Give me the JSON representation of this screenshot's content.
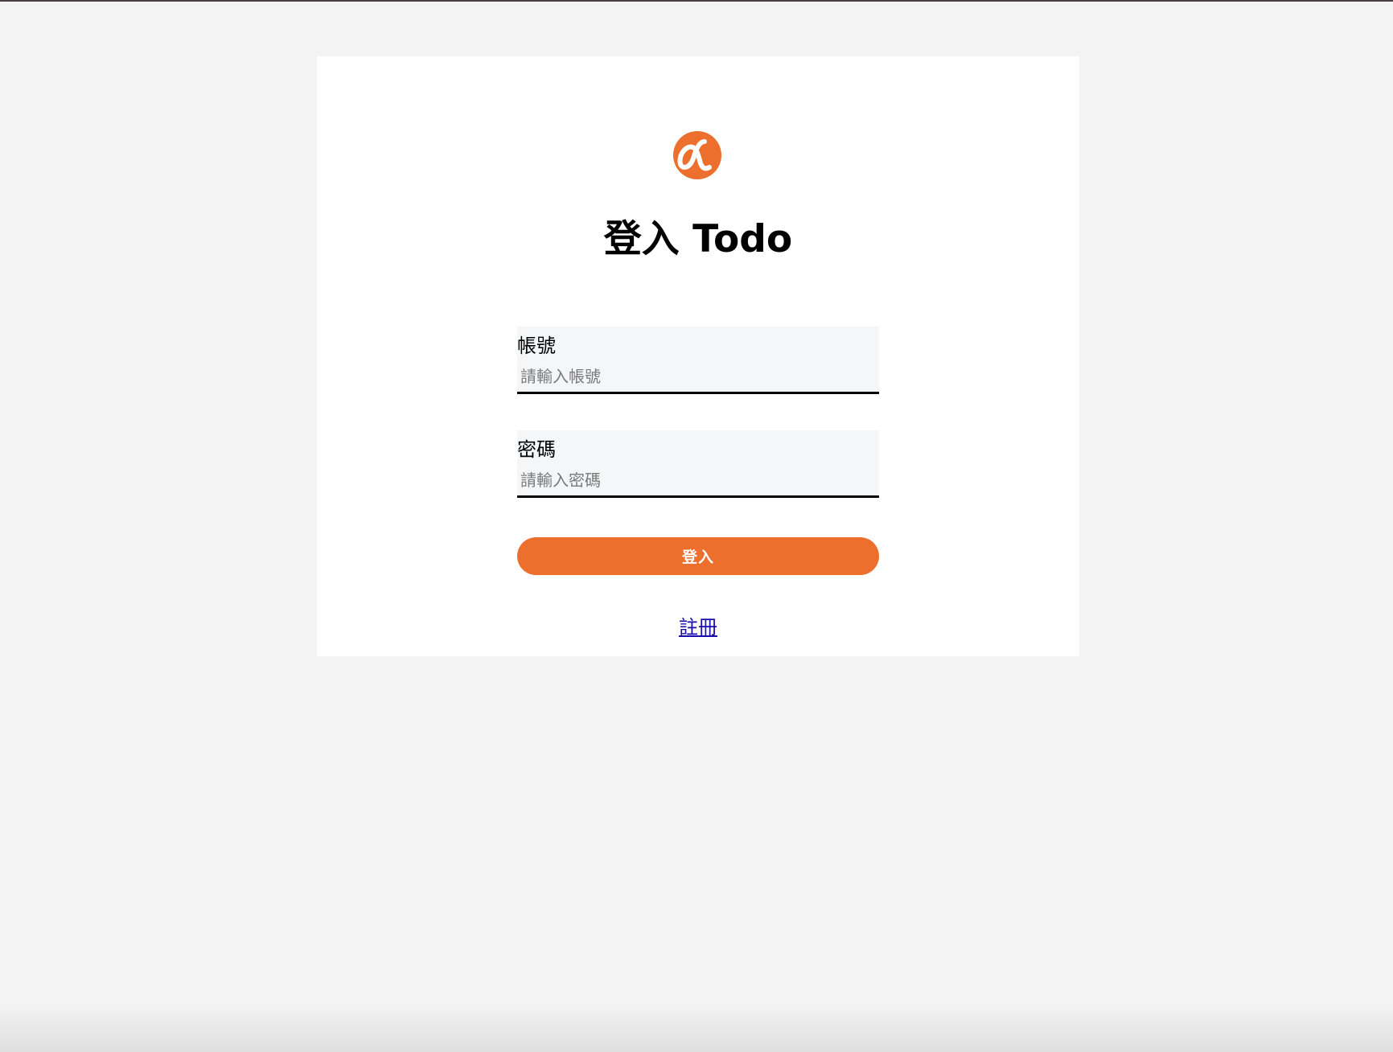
{
  "brand": {
    "logo_icon": "alpha-logo-icon",
    "accent_color": "#ed6f2e"
  },
  "login": {
    "title": "登入 Todo",
    "account": {
      "label": "帳號",
      "placeholder": "請輸入帳號",
      "value": ""
    },
    "password": {
      "label": "密碼",
      "placeholder": "請輸入密碼",
      "value": ""
    },
    "submit_label": "登入",
    "register_link": "註冊"
  }
}
